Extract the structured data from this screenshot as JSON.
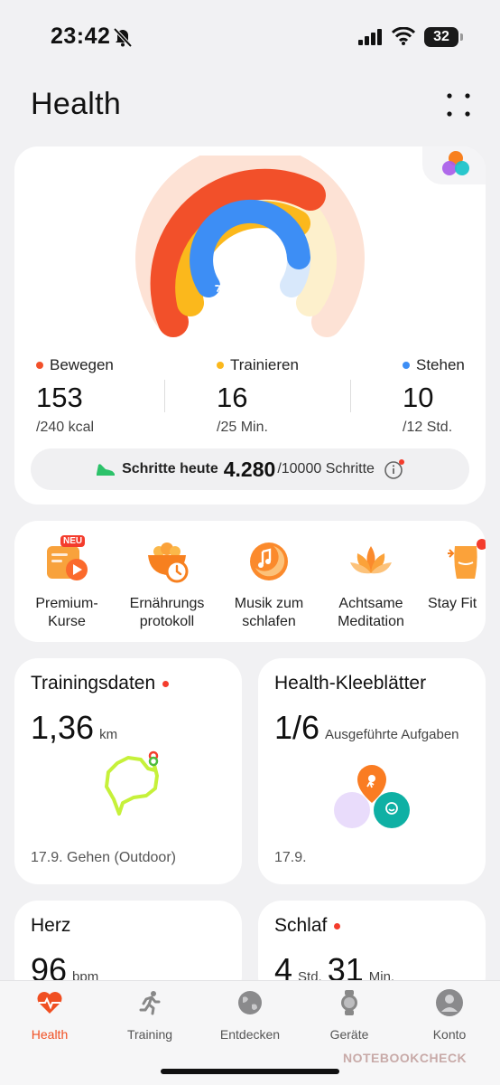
{
  "status_bar": {
    "time": "23:42",
    "battery": "32"
  },
  "header": {
    "title": "Health"
  },
  "activity": {
    "metrics": [
      {
        "label": "Bewegen",
        "value": "153",
        "goal": "/240 kcal",
        "color": "#f2502a"
      },
      {
        "label": "Trainieren",
        "value": "16",
        "goal": "/25 Min.",
        "color": "#fbb81c"
      },
      {
        "label": "Stehen",
        "value": "10",
        "goal": "/12 Std.",
        "color": "#3d8ef5"
      }
    ],
    "steps": {
      "label": "Schritte heute",
      "value": "4.280",
      "goal": "/10000 Schritte"
    }
  },
  "services": [
    {
      "label_line1": "Premium-",
      "label_line2": "Kurse",
      "badge": "NEU"
    },
    {
      "label_line1": "Ernährungs",
      "label_line2": "protokoll"
    },
    {
      "label_line1": "Musik zum",
      "label_line2": "schlafen"
    },
    {
      "label_line1": "Achtsame",
      "label_line2": "Meditation"
    },
    {
      "label_line1": "Stay Fit",
      "label_line2": ""
    }
  ],
  "training": {
    "title": "Trainingsdaten",
    "value": "1,36",
    "unit": "km",
    "footer": "17.9. Gehen (Outdoor)"
  },
  "clover": {
    "title": "Health-Kleeblätter",
    "value": "1/6",
    "unit": "Ausgeführte Aufgaben",
    "footer": "17.9."
  },
  "heart": {
    "title": "Herz",
    "value": "96",
    "unit": "bpm"
  },
  "sleep": {
    "title": "Schlaf",
    "hours": "4",
    "hours_unit": "Std.",
    "minutes": "31",
    "minutes_unit": "Min."
  },
  "tabs": [
    {
      "label": "Health",
      "icon": "heart-pulse-icon",
      "active": true
    },
    {
      "label": "Training",
      "icon": "runner-icon"
    },
    {
      "label": "Entdecken",
      "icon": "globe-icon"
    },
    {
      "label": "Geräte",
      "icon": "watch-icon"
    },
    {
      "label": "Konto",
      "icon": "person-icon"
    }
  ],
  "watermark": "NOTEBOOKCHECK",
  "colors": {
    "accent": "#f04f22",
    "move": "#f2502a",
    "exercise": "#fbb81c",
    "stand": "#3d8ef5"
  }
}
